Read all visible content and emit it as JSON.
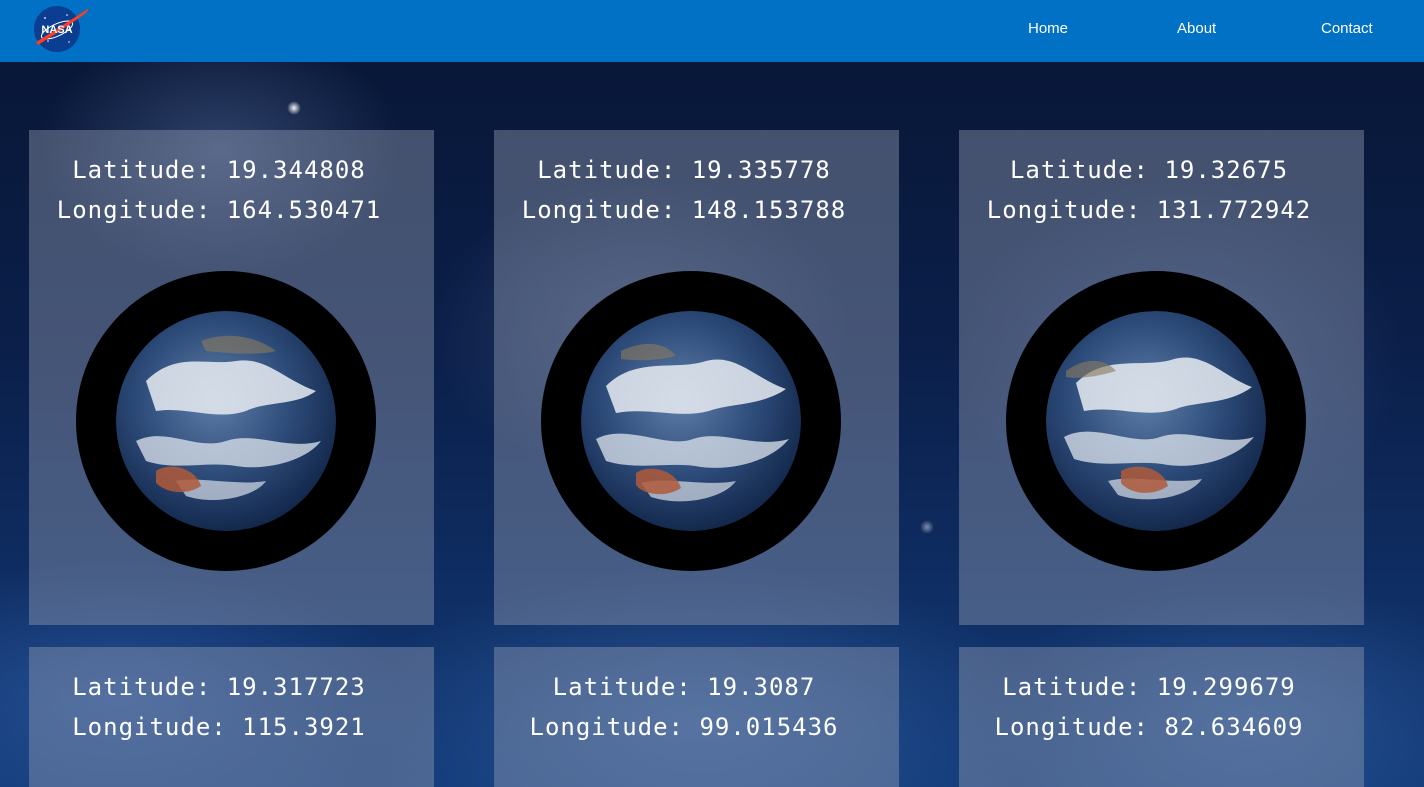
{
  "nav": {
    "logo_text": "NASA",
    "links": [
      "Home",
      "About",
      "Contact"
    ]
  },
  "colors": {
    "navbar": "#0071c5",
    "card_overlay": "rgba(150,160,180,0.42)",
    "globe_ring": "#000000"
  },
  "cards": [
    {
      "latitude": "Latitude: 19.344808",
      "longitude": "Longitude: 164.530471"
    },
    {
      "latitude": "Latitude: 19.335778",
      "longitude": "Longitude: 148.153788"
    },
    {
      "latitude": "Latitude: 19.32675",
      "longitude": "Longitude: 131.772942"
    },
    {
      "latitude": "Latitude: 19.317723",
      "longitude": "Longitude: 115.3921"
    },
    {
      "latitude": "Latitude: 19.3087",
      "longitude": "Longitude: 99.015436"
    },
    {
      "latitude": "Latitude: 19.299679",
      "longitude": "Longitude: 82.634609"
    }
  ],
  "icons": {
    "logo": "nasa-meatball-logo",
    "globe": "earth-globe-image"
  }
}
